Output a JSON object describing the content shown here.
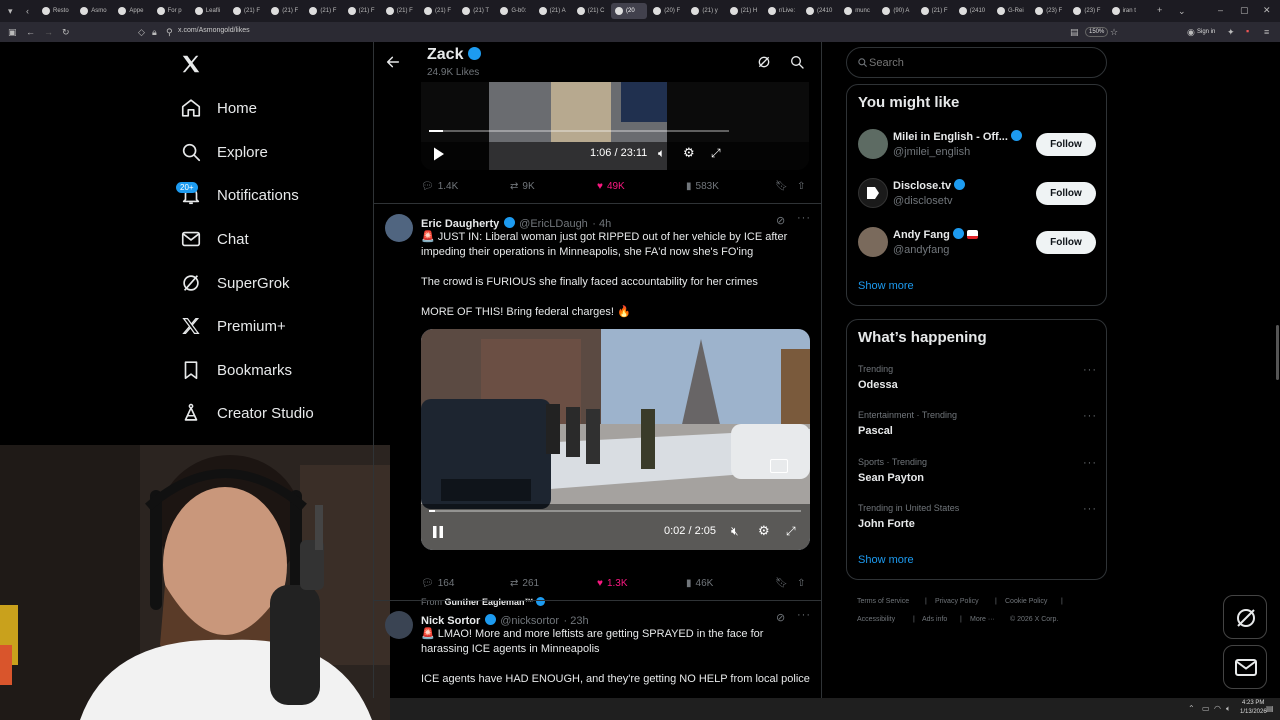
{
  "browser": {
    "tabs": [
      "Resto",
      "Asmo",
      "Appe",
      "For p",
      "Leafli",
      "(21) F",
      "(21) F",
      "(21) F",
      "(21) F",
      "(21) F",
      "(21) F",
      "(21) T",
      "G-b0:",
      "(21) A",
      "(21) C",
      "(20",
      "(20) F",
      "(21) y",
      "(21) H",
      "r/Live:",
      "(2410",
      "munc",
      "(90) A",
      "(21) F",
      "(2410",
      "G-Rei",
      "(23) F",
      "(23) F",
      "iran t"
    ],
    "url": "x.com/Asmongold/likes",
    "zoom": "150%",
    "sign_in": "Sign in"
  },
  "nav": {
    "items": [
      {
        "label": "Home",
        "icon": "home-icon"
      },
      {
        "label": "Explore",
        "icon": "search-icon"
      },
      {
        "label": "Notifications",
        "icon": "bell-icon"
      },
      {
        "label": "Chat",
        "icon": "mail-icon"
      },
      {
        "label": "SuperGrok",
        "icon": "grok-icon"
      },
      {
        "label": "Premium+",
        "icon": "x-logo-icon"
      },
      {
        "label": "Bookmarks",
        "icon": "bookmark-icon"
      },
      {
        "label": "Creator Studio",
        "icon": "flask-icon"
      }
    ],
    "notifications_badge": "20+"
  },
  "header": {
    "name": "Zack",
    "subtitle": "24.9K Likes"
  },
  "video1": {
    "time": "1:06 / 23:11",
    "progress": 0.047
  },
  "tweet0_actions": {
    "replies": "1.4K",
    "reposts": "9K",
    "likes": "49K",
    "views": "583K"
  },
  "tweet1": {
    "name": "Eric Daugherty",
    "handle": "@EricLDaugh",
    "time": "· 4h",
    "line1": "🚨 JUST IN: Liberal woman just got RIPPED out of her vehicle by ICE after impeding their operations in Minneapolis, she FA'd now she's FO'ing",
    "line2": "The crowd is FURIOUS she finally faced accountability for her crimes",
    "line3": "MORE OF THIS! Bring federal charges! 🔥",
    "video_time": "0:02 / 2:05",
    "video_progress": 0.016,
    "from_label": "From",
    "from_name": "Gunther Eagleman™",
    "replies": "164",
    "reposts": "261",
    "likes": "1.3K",
    "views": "46K"
  },
  "tweet2": {
    "name": "Nick Sortor",
    "handle": "@nicksortor",
    "time": "· 23h",
    "line1": "🚨 LMAO! More and more leftists are getting SPRAYED in the face for harassing ICE agents in Minneapolis",
    "line2": "ICE agents have HAD ENOUGH, and they're getting NO HELP from local police"
  },
  "search": {
    "placeholder": "Search"
  },
  "suggestions": {
    "title": "You might like",
    "items": [
      {
        "name": "Milei in English - Off...",
        "handle": "@jmilei_english",
        "button": "Follow"
      },
      {
        "name": "Disclose.tv",
        "handle": "@disclosetv",
        "button": "Follow"
      },
      {
        "name": "Andy Fang",
        "handle": "@andyfang",
        "button": "Follow"
      }
    ],
    "show_more": "Show more"
  },
  "trends": {
    "title": "What’s happening",
    "items": [
      {
        "meta": "Trending",
        "name": "Odessa"
      },
      {
        "meta": "Entertainment · Trending",
        "name": "Pascal"
      },
      {
        "meta": "Sports · Trending",
        "name": "Sean Payton"
      },
      {
        "meta": "Trending in United States",
        "name": "John Forte"
      }
    ],
    "show_more": "Show more"
  },
  "footer": {
    "links": [
      "Terms of Service",
      "|",
      "Privacy Policy",
      "|",
      "Cookie Policy",
      "|",
      "Accessibility",
      "|",
      "Ads info",
      "|",
      "More ···",
      "© 2026 X Corp."
    ]
  },
  "taskbar": {
    "time": "4:23 PM",
    "date": "1/13/2026"
  },
  "colors": {
    "accent": "#1d9bf0",
    "like": "#f91880",
    "background": "#000000",
    "border": "#2f3336",
    "muted": "#71767b"
  }
}
